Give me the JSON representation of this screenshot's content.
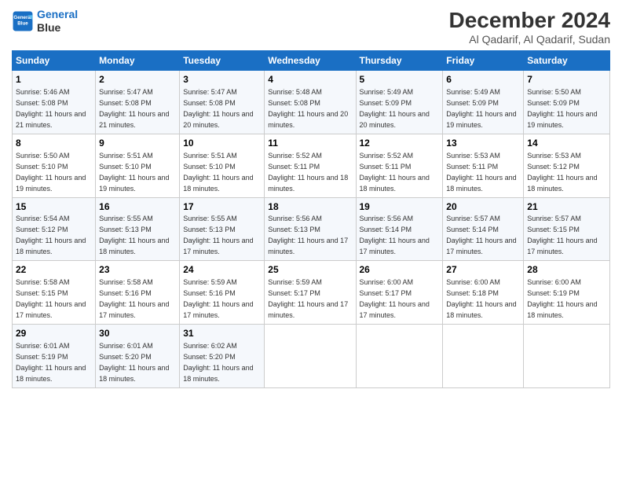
{
  "header": {
    "logo_line1": "General",
    "logo_line2": "Blue",
    "month": "December 2024",
    "location": "Al Qadarif, Al Qadarif, Sudan"
  },
  "weekdays": [
    "Sunday",
    "Monday",
    "Tuesday",
    "Wednesday",
    "Thursday",
    "Friday",
    "Saturday"
  ],
  "weeks": [
    [
      {
        "day": "1",
        "sunrise": "5:46 AM",
        "sunset": "5:08 PM",
        "daylight": "11 hours and 21 minutes."
      },
      {
        "day": "2",
        "sunrise": "5:47 AM",
        "sunset": "5:08 PM",
        "daylight": "11 hours and 21 minutes."
      },
      {
        "day": "3",
        "sunrise": "5:47 AM",
        "sunset": "5:08 PM",
        "daylight": "11 hours and 20 minutes."
      },
      {
        "day": "4",
        "sunrise": "5:48 AM",
        "sunset": "5:08 PM",
        "daylight": "11 hours and 20 minutes."
      },
      {
        "day": "5",
        "sunrise": "5:49 AM",
        "sunset": "5:09 PM",
        "daylight": "11 hours and 20 minutes."
      },
      {
        "day": "6",
        "sunrise": "5:49 AM",
        "sunset": "5:09 PM",
        "daylight": "11 hours and 19 minutes."
      },
      {
        "day": "7",
        "sunrise": "5:50 AM",
        "sunset": "5:09 PM",
        "daylight": "11 hours and 19 minutes."
      }
    ],
    [
      {
        "day": "8",
        "sunrise": "5:50 AM",
        "sunset": "5:10 PM",
        "daylight": "11 hours and 19 minutes."
      },
      {
        "day": "9",
        "sunrise": "5:51 AM",
        "sunset": "5:10 PM",
        "daylight": "11 hours and 19 minutes."
      },
      {
        "day": "10",
        "sunrise": "5:51 AM",
        "sunset": "5:10 PM",
        "daylight": "11 hours and 18 minutes."
      },
      {
        "day": "11",
        "sunrise": "5:52 AM",
        "sunset": "5:11 PM",
        "daylight": "11 hours and 18 minutes."
      },
      {
        "day": "12",
        "sunrise": "5:52 AM",
        "sunset": "5:11 PM",
        "daylight": "11 hours and 18 minutes."
      },
      {
        "day": "13",
        "sunrise": "5:53 AM",
        "sunset": "5:11 PM",
        "daylight": "11 hours and 18 minutes."
      },
      {
        "day": "14",
        "sunrise": "5:53 AM",
        "sunset": "5:12 PM",
        "daylight": "11 hours and 18 minutes."
      }
    ],
    [
      {
        "day": "15",
        "sunrise": "5:54 AM",
        "sunset": "5:12 PM",
        "daylight": "11 hours and 18 minutes."
      },
      {
        "day": "16",
        "sunrise": "5:55 AM",
        "sunset": "5:13 PM",
        "daylight": "11 hours and 18 minutes."
      },
      {
        "day": "17",
        "sunrise": "5:55 AM",
        "sunset": "5:13 PM",
        "daylight": "11 hours and 17 minutes."
      },
      {
        "day": "18",
        "sunrise": "5:56 AM",
        "sunset": "5:13 PM",
        "daylight": "11 hours and 17 minutes."
      },
      {
        "day": "19",
        "sunrise": "5:56 AM",
        "sunset": "5:14 PM",
        "daylight": "11 hours and 17 minutes."
      },
      {
        "day": "20",
        "sunrise": "5:57 AM",
        "sunset": "5:14 PM",
        "daylight": "11 hours and 17 minutes."
      },
      {
        "day": "21",
        "sunrise": "5:57 AM",
        "sunset": "5:15 PM",
        "daylight": "11 hours and 17 minutes."
      }
    ],
    [
      {
        "day": "22",
        "sunrise": "5:58 AM",
        "sunset": "5:15 PM",
        "daylight": "11 hours and 17 minutes."
      },
      {
        "day": "23",
        "sunrise": "5:58 AM",
        "sunset": "5:16 PM",
        "daylight": "11 hours and 17 minutes."
      },
      {
        "day": "24",
        "sunrise": "5:59 AM",
        "sunset": "5:16 PM",
        "daylight": "11 hours and 17 minutes."
      },
      {
        "day": "25",
        "sunrise": "5:59 AM",
        "sunset": "5:17 PM",
        "daylight": "11 hours and 17 minutes."
      },
      {
        "day": "26",
        "sunrise": "6:00 AM",
        "sunset": "5:17 PM",
        "daylight": "11 hours and 17 minutes."
      },
      {
        "day": "27",
        "sunrise": "6:00 AM",
        "sunset": "5:18 PM",
        "daylight": "11 hours and 18 minutes."
      },
      {
        "day": "28",
        "sunrise": "6:00 AM",
        "sunset": "5:19 PM",
        "daylight": "11 hours and 18 minutes."
      }
    ],
    [
      {
        "day": "29",
        "sunrise": "6:01 AM",
        "sunset": "5:19 PM",
        "daylight": "11 hours and 18 minutes."
      },
      {
        "day": "30",
        "sunrise": "6:01 AM",
        "sunset": "5:20 PM",
        "daylight": "11 hours and 18 minutes."
      },
      {
        "day": "31",
        "sunrise": "6:02 AM",
        "sunset": "5:20 PM",
        "daylight": "11 hours and 18 minutes."
      },
      null,
      null,
      null,
      null
    ]
  ]
}
